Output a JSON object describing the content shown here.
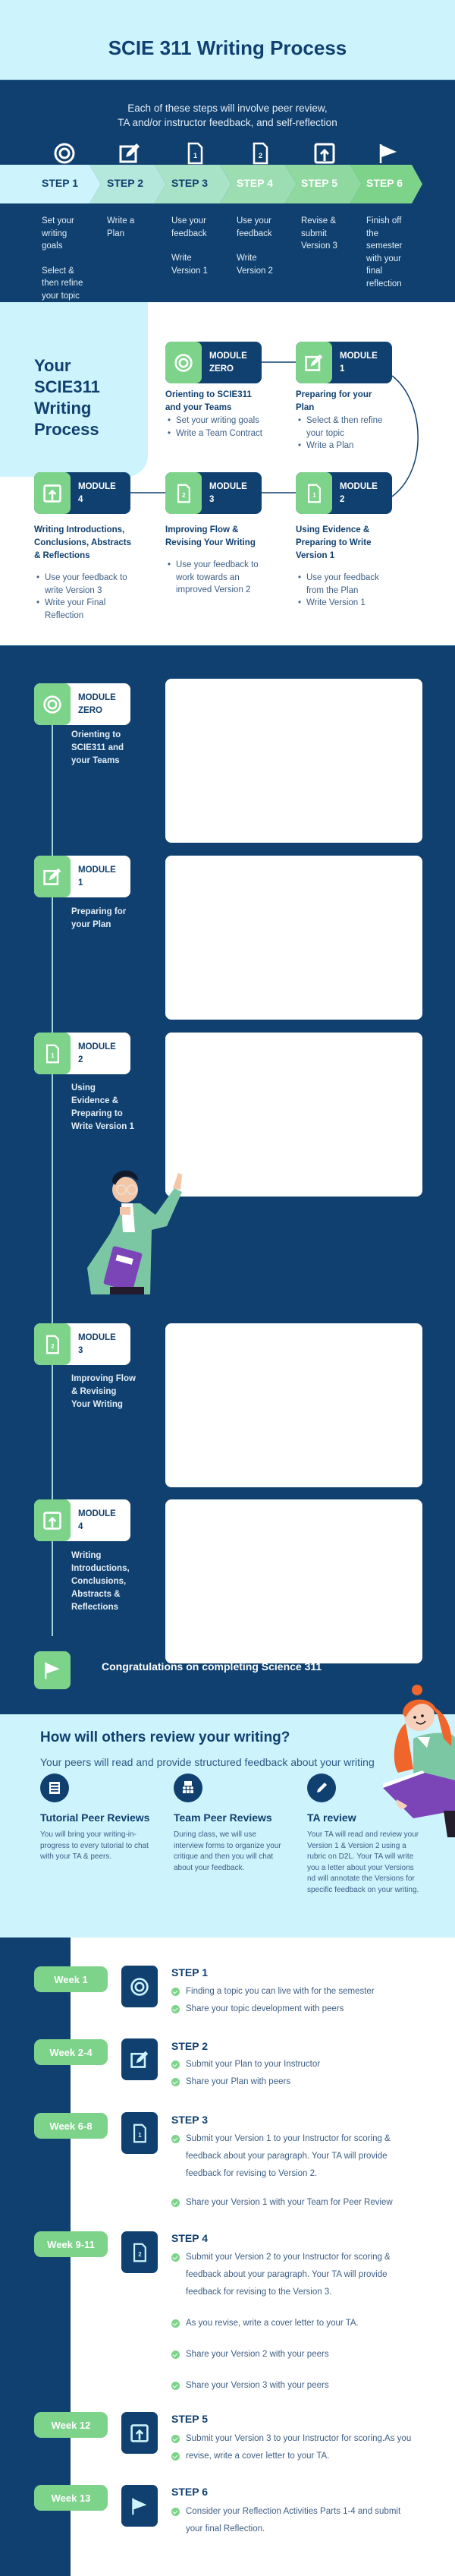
{
  "header": {
    "title": "SCIE 311 Writing Process"
  },
  "overview": {
    "subtitle_line1": "Each of these steps will involve peer review,",
    "subtitle_line2": "TA and/or instructor feedback, and self-reflection",
    "steps": [
      {
        "label": "STEP 1",
        "icon": "target-icon",
        "band_color": "#cdf3fc",
        "label_color": "#10406f",
        "text": [
          "Set your writing goals",
          "Select & then refine your topic"
        ]
      },
      {
        "label": "STEP 2",
        "icon": "edit-icon",
        "band_color": "#b5e8dc",
        "label_color": "#10406f",
        "text": [
          "Write a Plan"
        ]
      },
      {
        "label": "STEP 3",
        "icon": "document-1-icon",
        "band_color": "#a8e3c8",
        "label_color": "#10406f",
        "text": [
          "Use your feedback",
          "Write Version 1"
        ]
      },
      {
        "label": "STEP 4",
        "icon": "document-2-icon",
        "band_color": "#9cddb2",
        "label_color": "#ffffff",
        "text": [
          "Use your feedback",
          "Write Version 2"
        ]
      },
      {
        "label": "STEP 5",
        "icon": "upload-icon",
        "band_color": "#8fd8a0",
        "label_color": "#ffffff",
        "text": [
          "Revise & submit Version 3"
        ]
      },
      {
        "label": "STEP 6",
        "icon": "flag-icon",
        "band_color": "#7dd38a",
        "label_color": "#ffffff",
        "text": [
          "Finish off the semester with your final reflection"
        ]
      }
    ]
  },
  "modules_map": {
    "title": "Your SCIE311 Writing Process",
    "modules": [
      {
        "label_line1": "MODULE",
        "label_line2": "ZERO",
        "heading": "Orienting to SCIE311 and your Teams",
        "items": [
          "Set your writing goals",
          "Write a Team Contract"
        ]
      },
      {
        "label_line1": "MODULE",
        "label_line2": "1",
        "heading": "Preparing for your Plan",
        "items": [
          "Select & then refine your topic",
          "Write a Plan"
        ]
      },
      {
        "label_line1": "MODULE",
        "label_line2": "2",
        "heading": "Using Evidence & Preparing to Write Version 1",
        "items": [
          "Use your feedback from the Plan",
          "Write Version 1"
        ]
      },
      {
        "label_line1": "MODULE",
        "label_line2": "3",
        "heading": "Improving Flow & Revising Your Writing",
        "items": [
          "Use your feedback to work towards an improved Version 2"
        ]
      },
      {
        "label_line1": "MODULE",
        "label_line2": "4",
        "heading": "Writing Introductions, Conclusions, Abstracts & Reflections",
        "items": [
          "Use your feedback to write Version 3",
          "Write your Final Reflection"
        ]
      }
    ]
  },
  "timeline": {
    "modules": [
      {
        "label_line1": "MODULE",
        "label_line2": "ZERO",
        "description": "Orienting to SCIE311 and your Teams"
      },
      {
        "label_line1": "MODULE",
        "label_line2": "1",
        "description": "Preparing for your Plan"
      },
      {
        "label_line1": "MODULE",
        "label_line2": "2",
        "description": "Using Evidence & Preparing to Write Version 1"
      },
      {
        "label_line1": "MODULE",
        "label_line2": "3",
        "description": "Improving Flow & Revising Your Writing"
      },
      {
        "label_line1": "MODULE",
        "label_line2": "4",
        "description": "Writing Introductions, Conclusions, Abstracts & Reflections"
      }
    ],
    "congrats": "Congratulations on completing Science 311"
  },
  "review": {
    "title": "How will others review your writing?",
    "subtitle": "Your peers will read and provide structured feedback about your writing",
    "types": [
      {
        "icon": "document-list-icon",
        "title": "Tutorial Peer Reviews",
        "text": "You will bring your writing-in-progress to every tutorial to chat with your TA & peers."
      },
      {
        "icon": "team-presentation-icon",
        "title": "Team Peer Reviews",
        "text": "During class, we will use interview forms to organize your critique and then you will chat about your feedback."
      },
      {
        "icon": "pencil-icon",
        "title": "TA review",
        "text": "Your TA will read and review your Version 1 & Version 2 using a rubric on D2L. Your TA will write you a letter about your Versions nd will annotate the Versions for specific feedback on your writing."
      }
    ]
  },
  "schedule": {
    "weeks": [
      {
        "week": "Week 1",
        "step": "STEP 1",
        "icon": "target-icon",
        "items": [
          "Finding a topic you can live with for the semester",
          "Share your topic development with peers"
        ]
      },
      {
        "week": "Week 2-4",
        "step": "STEP 2",
        "icon": "edit-icon",
        "items": [
          "Submit your Plan to your Instructor",
          "Share your Plan with peers"
        ]
      },
      {
        "week": "Week 6-8",
        "step": "STEP 3",
        "icon": "document-1-icon",
        "items": [
          "Submit your Version 1 to your Instructor for scoring & feedback about your paragraph. Your TA will provide feedback for revising to Version 2.",
          "Share your Version 1 with your Team for Peer Review"
        ]
      },
      {
        "week": "Week 9-11",
        "step": "STEP 4",
        "icon": "document-2-icon",
        "items": [
          "Submit your Version 2 to your Instructor for scoring & feedback about your paragraph. Your TA will provide feedback for revising to the  Version 3.",
          "As you revise, write a cover letter to your TA.",
          "Share your Version 2 with your peers",
          "Share your Version 3 with your peers"
        ]
      },
      {
        "week": "Week 12",
        "step": "STEP 5",
        "icon": "upload-icon",
        "items": [
          "Submit your  Version 3 to your Instructor for scoring.As you",
          "revise, write a cover letter to your TA."
        ]
      },
      {
        "week": "Week 13",
        "step": "STEP 6",
        "icon": "flag-icon",
        "items": [
          "Consider your Reflection Activities Parts 1-4 and submit your final Reflection."
        ]
      }
    ]
  },
  "colors": {
    "navy": "#10406f",
    "green": "#7dd38a",
    "light_blue": "#cdf3fc"
  }
}
